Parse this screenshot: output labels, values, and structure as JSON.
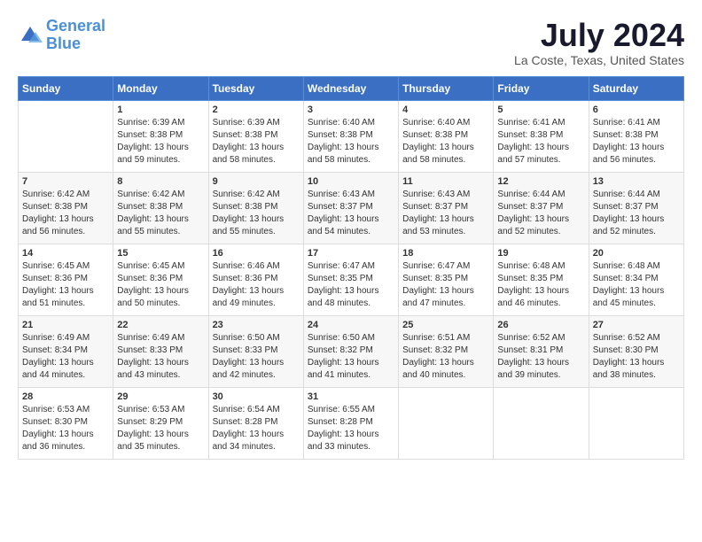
{
  "header": {
    "logo_line1": "General",
    "logo_line2": "Blue",
    "month_year": "July 2024",
    "location": "La Coste, Texas, United States"
  },
  "days_of_week": [
    "Sunday",
    "Monday",
    "Tuesday",
    "Wednesday",
    "Thursday",
    "Friday",
    "Saturday"
  ],
  "weeks": [
    [
      {
        "day": "",
        "sunrise": "",
        "sunset": "",
        "daylight": ""
      },
      {
        "day": "1",
        "sunrise": "Sunrise: 6:39 AM",
        "sunset": "Sunset: 8:38 PM",
        "daylight": "Daylight: 13 hours and 59 minutes."
      },
      {
        "day": "2",
        "sunrise": "Sunrise: 6:39 AM",
        "sunset": "Sunset: 8:38 PM",
        "daylight": "Daylight: 13 hours and 58 minutes."
      },
      {
        "day": "3",
        "sunrise": "Sunrise: 6:40 AM",
        "sunset": "Sunset: 8:38 PM",
        "daylight": "Daylight: 13 hours and 58 minutes."
      },
      {
        "day": "4",
        "sunrise": "Sunrise: 6:40 AM",
        "sunset": "Sunset: 8:38 PM",
        "daylight": "Daylight: 13 hours and 58 minutes."
      },
      {
        "day": "5",
        "sunrise": "Sunrise: 6:41 AM",
        "sunset": "Sunset: 8:38 PM",
        "daylight": "Daylight: 13 hours and 57 minutes."
      },
      {
        "day": "6",
        "sunrise": "Sunrise: 6:41 AM",
        "sunset": "Sunset: 8:38 PM",
        "daylight": "Daylight: 13 hours and 56 minutes."
      }
    ],
    [
      {
        "day": "7",
        "sunrise": "Sunrise: 6:42 AM",
        "sunset": "Sunset: 8:38 PM",
        "daylight": "Daylight: 13 hours and 56 minutes."
      },
      {
        "day": "8",
        "sunrise": "Sunrise: 6:42 AM",
        "sunset": "Sunset: 8:38 PM",
        "daylight": "Daylight: 13 hours and 55 minutes."
      },
      {
        "day": "9",
        "sunrise": "Sunrise: 6:42 AM",
        "sunset": "Sunset: 8:38 PM",
        "daylight": "Daylight: 13 hours and 55 minutes."
      },
      {
        "day": "10",
        "sunrise": "Sunrise: 6:43 AM",
        "sunset": "Sunset: 8:37 PM",
        "daylight": "Daylight: 13 hours and 54 minutes."
      },
      {
        "day": "11",
        "sunrise": "Sunrise: 6:43 AM",
        "sunset": "Sunset: 8:37 PM",
        "daylight": "Daylight: 13 hours and 53 minutes."
      },
      {
        "day": "12",
        "sunrise": "Sunrise: 6:44 AM",
        "sunset": "Sunset: 8:37 PM",
        "daylight": "Daylight: 13 hours and 52 minutes."
      },
      {
        "day": "13",
        "sunrise": "Sunrise: 6:44 AM",
        "sunset": "Sunset: 8:37 PM",
        "daylight": "Daylight: 13 hours and 52 minutes."
      }
    ],
    [
      {
        "day": "14",
        "sunrise": "Sunrise: 6:45 AM",
        "sunset": "Sunset: 8:36 PM",
        "daylight": "Daylight: 13 hours and 51 minutes."
      },
      {
        "day": "15",
        "sunrise": "Sunrise: 6:45 AM",
        "sunset": "Sunset: 8:36 PM",
        "daylight": "Daylight: 13 hours and 50 minutes."
      },
      {
        "day": "16",
        "sunrise": "Sunrise: 6:46 AM",
        "sunset": "Sunset: 8:36 PM",
        "daylight": "Daylight: 13 hours and 49 minutes."
      },
      {
        "day": "17",
        "sunrise": "Sunrise: 6:47 AM",
        "sunset": "Sunset: 8:35 PM",
        "daylight": "Daylight: 13 hours and 48 minutes."
      },
      {
        "day": "18",
        "sunrise": "Sunrise: 6:47 AM",
        "sunset": "Sunset: 8:35 PM",
        "daylight": "Daylight: 13 hours and 47 minutes."
      },
      {
        "day": "19",
        "sunrise": "Sunrise: 6:48 AM",
        "sunset": "Sunset: 8:35 PM",
        "daylight": "Daylight: 13 hours and 46 minutes."
      },
      {
        "day": "20",
        "sunrise": "Sunrise: 6:48 AM",
        "sunset": "Sunset: 8:34 PM",
        "daylight": "Daylight: 13 hours and 45 minutes."
      }
    ],
    [
      {
        "day": "21",
        "sunrise": "Sunrise: 6:49 AM",
        "sunset": "Sunset: 8:34 PM",
        "daylight": "Daylight: 13 hours and 44 minutes."
      },
      {
        "day": "22",
        "sunrise": "Sunrise: 6:49 AM",
        "sunset": "Sunset: 8:33 PM",
        "daylight": "Daylight: 13 hours and 43 minutes."
      },
      {
        "day": "23",
        "sunrise": "Sunrise: 6:50 AM",
        "sunset": "Sunset: 8:33 PM",
        "daylight": "Daylight: 13 hours and 42 minutes."
      },
      {
        "day": "24",
        "sunrise": "Sunrise: 6:50 AM",
        "sunset": "Sunset: 8:32 PM",
        "daylight": "Daylight: 13 hours and 41 minutes."
      },
      {
        "day": "25",
        "sunrise": "Sunrise: 6:51 AM",
        "sunset": "Sunset: 8:32 PM",
        "daylight": "Daylight: 13 hours and 40 minutes."
      },
      {
        "day": "26",
        "sunrise": "Sunrise: 6:52 AM",
        "sunset": "Sunset: 8:31 PM",
        "daylight": "Daylight: 13 hours and 39 minutes."
      },
      {
        "day": "27",
        "sunrise": "Sunrise: 6:52 AM",
        "sunset": "Sunset: 8:30 PM",
        "daylight": "Daylight: 13 hours and 38 minutes."
      }
    ],
    [
      {
        "day": "28",
        "sunrise": "Sunrise: 6:53 AM",
        "sunset": "Sunset: 8:30 PM",
        "daylight": "Daylight: 13 hours and 36 minutes."
      },
      {
        "day": "29",
        "sunrise": "Sunrise: 6:53 AM",
        "sunset": "Sunset: 8:29 PM",
        "daylight": "Daylight: 13 hours and 35 minutes."
      },
      {
        "day": "30",
        "sunrise": "Sunrise: 6:54 AM",
        "sunset": "Sunset: 8:28 PM",
        "daylight": "Daylight: 13 hours and 34 minutes."
      },
      {
        "day": "31",
        "sunrise": "Sunrise: 6:55 AM",
        "sunset": "Sunset: 8:28 PM",
        "daylight": "Daylight: 13 hours and 33 minutes."
      },
      {
        "day": "",
        "sunrise": "",
        "sunset": "",
        "daylight": ""
      },
      {
        "day": "",
        "sunrise": "",
        "sunset": "",
        "daylight": ""
      },
      {
        "day": "",
        "sunrise": "",
        "sunset": "",
        "daylight": ""
      }
    ]
  ]
}
